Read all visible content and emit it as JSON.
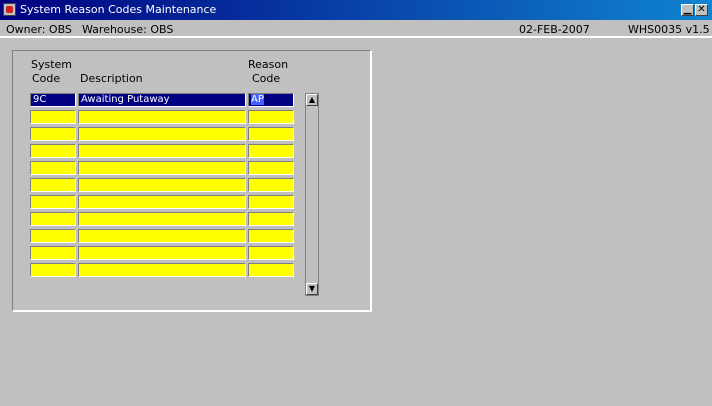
{
  "window": {
    "title": "System Reason Codes Maintenance",
    "minimize_glyph": "▁",
    "close_glyph": "✕"
  },
  "infobar": {
    "owner": "Owner: OBS",
    "warehouse": "Warehouse: OBS",
    "date": "02-FEB-2007",
    "version": "WHS0035 v1.5"
  },
  "table": {
    "headers": {
      "system_code_line1": "System",
      "system_code_line2": "Code",
      "description": "Description",
      "reason_code_line1": "Reason",
      "reason_code_line2": "Code"
    },
    "rows": [
      {
        "system_code": "9C",
        "description": "Awaiting Putaway",
        "reason_code": "AP"
      },
      {
        "system_code": "",
        "description": "",
        "reason_code": ""
      },
      {
        "system_code": "",
        "description": "",
        "reason_code": ""
      },
      {
        "system_code": "",
        "description": "",
        "reason_code": ""
      },
      {
        "system_code": "",
        "description": "",
        "reason_code": ""
      },
      {
        "system_code": "",
        "description": "",
        "reason_code": ""
      },
      {
        "system_code": "",
        "description": "",
        "reason_code": ""
      },
      {
        "system_code": "",
        "description": "",
        "reason_code": ""
      },
      {
        "system_code": "",
        "description": "",
        "reason_code": ""
      },
      {
        "system_code": "",
        "description": "",
        "reason_code": ""
      },
      {
        "system_code": "",
        "description": "",
        "reason_code": ""
      }
    ]
  },
  "scrollbar": {
    "up_glyph": "▲",
    "down_glyph": "▼",
    "up_icon": "arrow-up-icon",
    "down_icon": "arrow-down-icon"
  },
  "colors": {
    "field_bg": "#ffff00",
    "selected_bg": "#000080",
    "window_bg": "#c0c0c0"
  }
}
